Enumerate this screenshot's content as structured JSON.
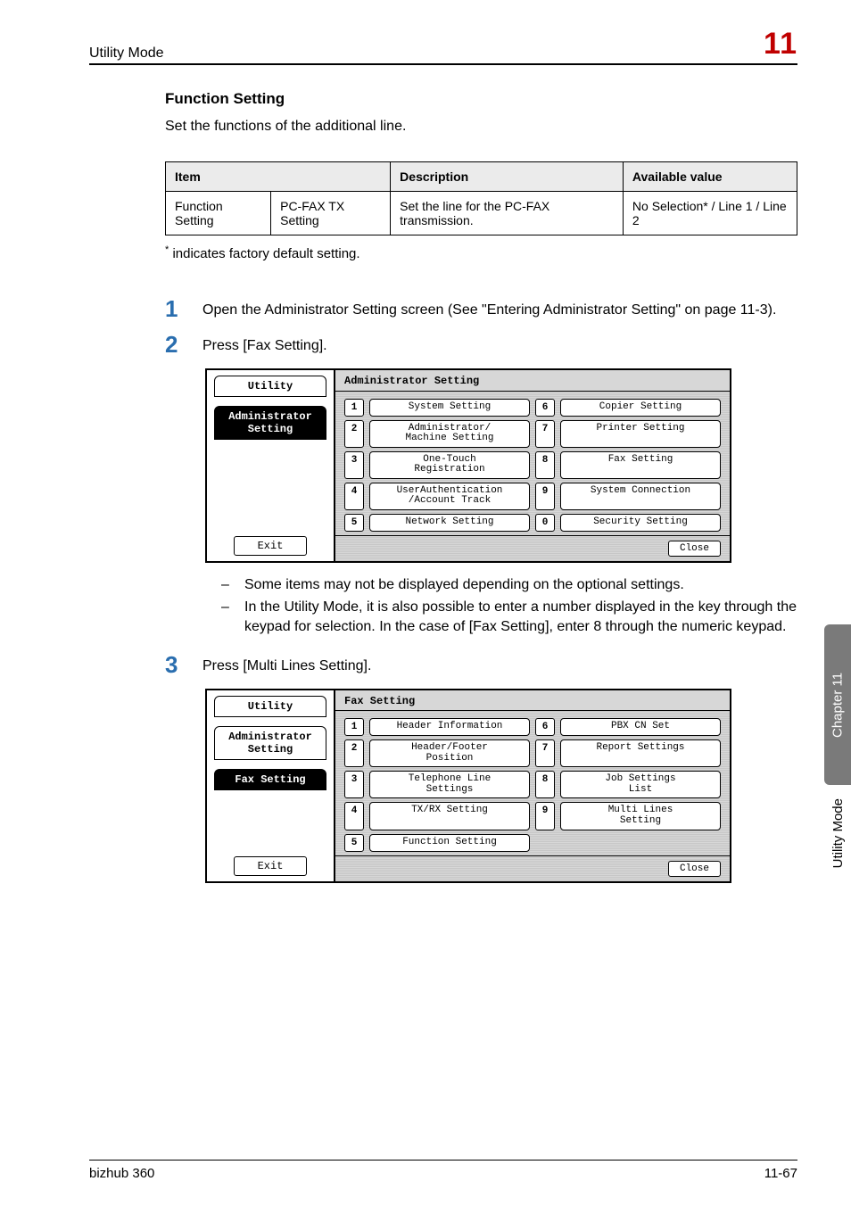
{
  "header": {
    "section": "Utility Mode",
    "chapter_number": "11"
  },
  "side": {
    "chapter_tab": "Chapter 11",
    "mode": "Utility Mode"
  },
  "section": {
    "title": "Function Setting",
    "intro": "Set the functions of the additional line."
  },
  "table": {
    "headers": {
      "item": "Item",
      "desc": "Description",
      "avail": "Available value"
    },
    "row": {
      "item1": "Function Setting",
      "item2": "PC-FAX TX Setting",
      "desc": "Set the line for the PC-FAX transmission.",
      "avail": "No Selection* / Line 1 / Line 2"
    }
  },
  "footnote": "indicates factory default setting.",
  "steps": {
    "s1": "Open the Administrator Setting screen (See \"Entering Administrator Setting\" on page 11-3).",
    "s2": "Press [Fax Setting].",
    "s3": "Press [Multi Lines Setting]."
  },
  "notes": {
    "n1": "Some items may not be displayed depending on the optional settings.",
    "n2": "In the Utility Mode, it is also possible to enter a number displayed in the key through the keypad for selection. In the case of [Fax Setting], enter 8 through the numeric keypad."
  },
  "screens": {
    "admin": {
      "left_label": "Utility",
      "left_selected": "Administrator\nSetting",
      "title": "Administrator\nSetting",
      "exit": "Exit",
      "close": "Close",
      "items": [
        {
          "n": "1",
          "label": "System Setting"
        },
        {
          "n": "2",
          "label": "Administrator/\nMachine Setting"
        },
        {
          "n": "3",
          "label": "One-Touch\nRegistration"
        },
        {
          "n": "4",
          "label": "UserAuthentication\n/Account Track"
        },
        {
          "n": "5",
          "label": "Network Setting"
        },
        {
          "n": "6",
          "label": "Copier Setting"
        },
        {
          "n": "7",
          "label": "Printer Setting"
        },
        {
          "n": "8",
          "label": "Fax Setting"
        },
        {
          "n": "9",
          "label": "System Connection"
        },
        {
          "n": "0",
          "label": "Security Setting"
        }
      ]
    },
    "fax": {
      "left_label": "Utility",
      "left_item1": "Administrator\nSetting",
      "left_item2": "Fax Setting",
      "title": "Fax Setting",
      "exit": "Exit",
      "close": "Close",
      "items": [
        {
          "n": "1",
          "label": "Header Information"
        },
        {
          "n": "2",
          "label": "Header/Footer\nPosition"
        },
        {
          "n": "3",
          "label": "Telephone Line\nSettings"
        },
        {
          "n": "4",
          "label": "TX/RX Setting"
        },
        {
          "n": "5",
          "label": "Function Setting"
        },
        {
          "n": "6",
          "label": "PBX CN Set"
        },
        {
          "n": "7",
          "label": "Report Settings"
        },
        {
          "n": "8",
          "label": "Job Settings\nList"
        },
        {
          "n": "9",
          "label": "Multi Lines\nSetting"
        }
      ]
    }
  },
  "footer": {
    "left": "bizhub 360",
    "right": "11-67"
  }
}
